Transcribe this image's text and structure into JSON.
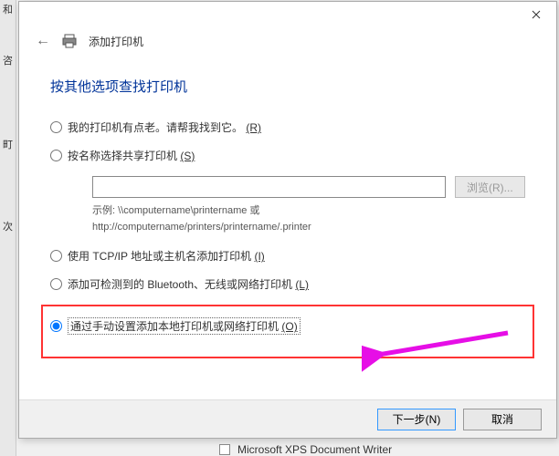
{
  "leftStrip": {
    "c1": "和",
    "c2": "咨",
    "c3": "町",
    "c4": "次"
  },
  "header": {
    "title": "添加打印机"
  },
  "mainTitle": "按其他选项查找打印机",
  "options": {
    "opt1": {
      "label": "我的打印机有点老。请帮我找到它。",
      "accel": "(R)"
    },
    "opt2": {
      "label": "按名称选择共享打印机",
      "accel": "(S)"
    },
    "pathInput": {
      "value": ""
    },
    "browse": {
      "label": "浏览(R)..."
    },
    "example": {
      "line1": "示例: \\\\computername\\printername 或",
      "line2": "http://computername/printers/printername/.printer"
    },
    "opt3": {
      "label": "使用 TCP/IP 地址或主机名添加打印机",
      "accel": "(I)"
    },
    "opt4": {
      "label": "添加可检测到的 Bluetooth、无线或网络打印机",
      "accel": "(L)"
    },
    "opt5": {
      "label": "通过手动设置添加本地打印机或网络打印机",
      "accel": "(O)"
    }
  },
  "buttons": {
    "next": "下一步(N)",
    "cancel": "取消"
  },
  "bottomFragment": "Microsoft XPS Document Writer"
}
